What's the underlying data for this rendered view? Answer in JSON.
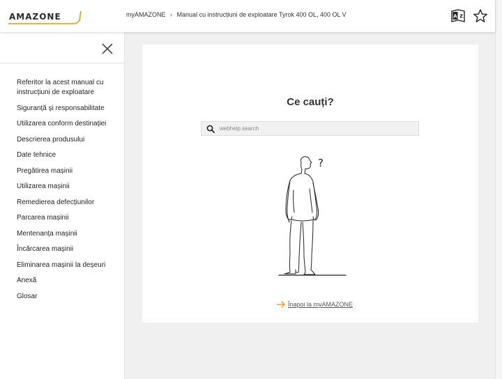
{
  "header": {
    "logo_text": "AMAZONE",
    "breadcrumb": [
      "myAMAZONE",
      "Manual cu instrucțiuni de exploatare Tyrok 400 OL, 400 OL V"
    ],
    "breadcrumb_separator": "›",
    "icons": [
      "language-icon",
      "favorite-star-icon"
    ]
  },
  "sidebar": {
    "items": [
      {
        "label": "Referitor la acest manual cu instrucțiuni de exploatare"
      },
      {
        "label": "Siguranță și responsabilitate"
      },
      {
        "label": "Utilizarea conform destinației"
      },
      {
        "label": "Descrierea produsului"
      },
      {
        "label": "Date tehnice"
      },
      {
        "label": "Pregătirea mașinii"
      },
      {
        "label": "Utilizarea mașinii"
      },
      {
        "label": "Remedierea defecțiunilor"
      },
      {
        "label": "Parcarea mașinii"
      },
      {
        "label": "Mentenanța mașinii"
      },
      {
        "label": "Încărcarea mașinii"
      },
      {
        "label": "Eliminarea mașinii la deșeuri"
      },
      {
        "label": "Anexă"
      },
      {
        "label": "Glosar"
      }
    ]
  },
  "main": {
    "title": "Ce cauți?",
    "search_placeholder": "webhelp.search",
    "question_mark": "?",
    "back_link": "Înapoi la myAMAZONE"
  },
  "colors": {
    "accent": "#f29400",
    "text": "#1f1f1f",
    "background": "#f0f0f0"
  }
}
